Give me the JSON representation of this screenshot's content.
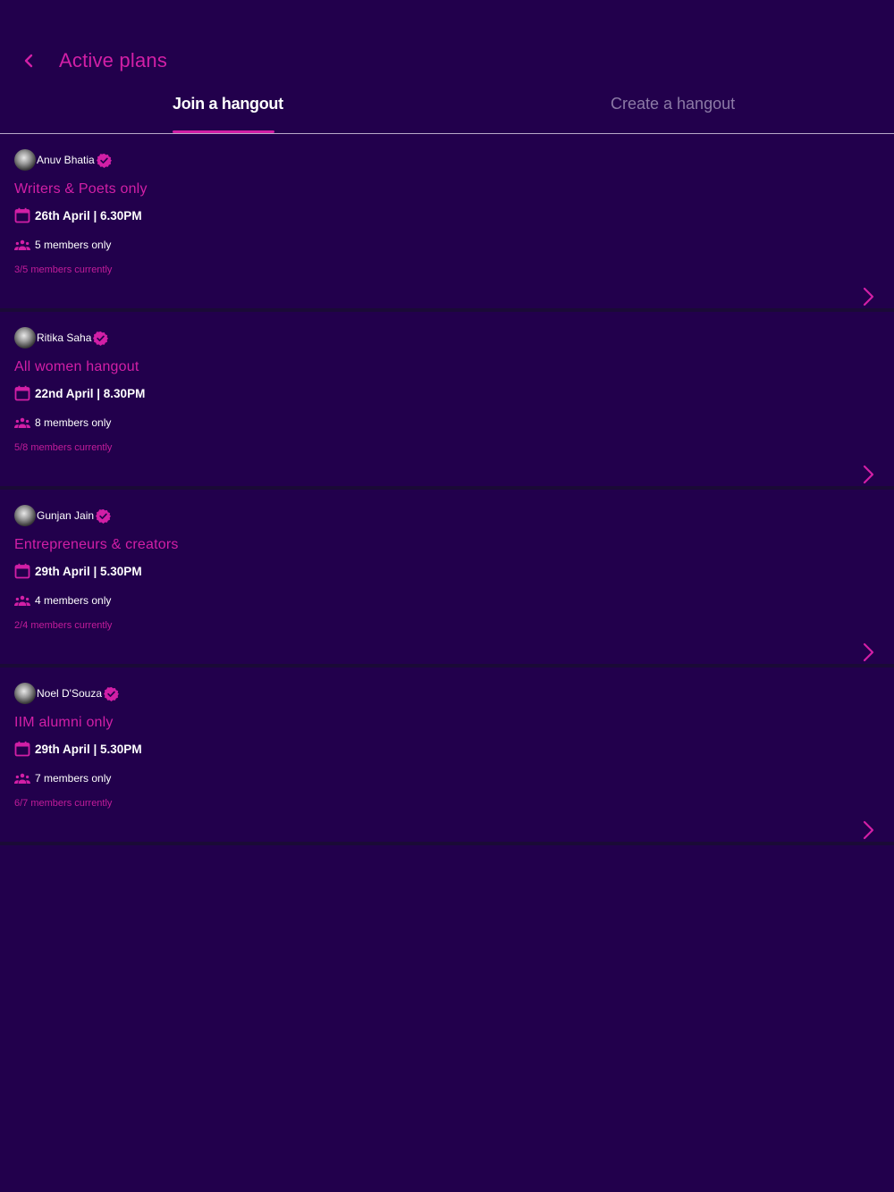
{
  "header": {
    "title": "Active plans",
    "back_icon": "chevron-left-icon"
  },
  "tabs": [
    {
      "label": "Join a hangout",
      "active": true
    },
    {
      "label": "Create a hangout",
      "active": false
    }
  ],
  "colors": {
    "background": "#22004c",
    "accent": "#d21fa6",
    "inactive_tab": "#8c7aa6",
    "divider": "#1a0a36"
  },
  "plans": [
    {
      "host": "Anuv Bhatia",
      "title": "Writers & Poets only",
      "date": "26th April | 6.30PM",
      "members": "5 members only",
      "current": "3/5 members currently"
    },
    {
      "host": "Ritika Saha",
      "title": "All women hangout",
      "date": "22nd April | 8.30PM",
      "members": "8 members only",
      "current": "5/8 members currently"
    },
    {
      "host": "Gunjan Jain",
      "title": "Entrepreneurs & creators",
      "date": "29th April | 5.30PM",
      "members": "4 members only",
      "current": "2/4 members currently"
    },
    {
      "host": "Noel D'Souza",
      "title": "IIM alumni only",
      "date": "29th April | 5.30PM",
      "members": "7 members only",
      "current": "6/7 members currently"
    }
  ]
}
